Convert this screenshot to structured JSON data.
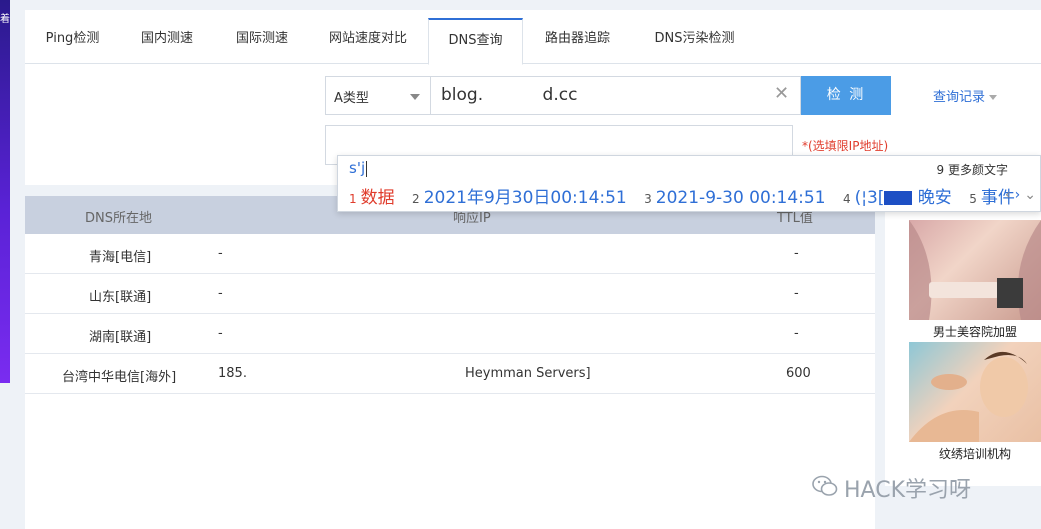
{
  "left_strip": {
    "glyph": "着"
  },
  "tabs": [
    {
      "label": "Ping检测"
    },
    {
      "label": "国内测速"
    },
    {
      "label": "国际测速"
    },
    {
      "label": "网站速度对比"
    },
    {
      "label": "DNS查询"
    },
    {
      "label": "路由器追踪"
    },
    {
      "label": "DNS污染检测"
    }
  ],
  "active_tab": "DNS查询",
  "query": {
    "type_value": "A类型",
    "domain_value": "blog.           d.cc",
    "check_button": "检  测",
    "history_link": "查询记录",
    "ip_placeholder": "",
    "ip_hint": "*(选填限IP地址)"
  },
  "ime": {
    "composition": "s'j",
    "more_label": "9 更多颜文字",
    "candidates": [
      {
        "num": "1",
        "text": "数据"
      },
      {
        "num": "2",
        "text": "2021年9月30日00:14:51"
      },
      {
        "num": "3",
        "text": "2021-9-30 00:14:51"
      },
      {
        "num": "4",
        "text": "(¦3[",
        "suffix": " 晚安"
      },
      {
        "num": "5",
        "text": "事件"
      }
    ],
    "nav_prev": "‹",
    "nav_next": "›",
    "nav_expand": "⌄"
  },
  "table": {
    "headers": {
      "location": "DNS所在地",
      "ip": "响应IP",
      "ttl": "TTL值"
    },
    "rows": [
      {
        "location": "青海[电信]",
        "ip": "-",
        "ip_extra": "",
        "ttl": "-"
      },
      {
        "location": "山东[联通]",
        "ip": "-",
        "ip_extra": "",
        "ttl": "-"
      },
      {
        "location": "湖南[联通]",
        "ip": "-",
        "ip_extra": "",
        "ttl": "-"
      },
      {
        "location": "台湾中华电信[海外]",
        "ip": "185.",
        "ip_extra": "Heymman Servers]",
        "ttl": "600"
      }
    ]
  },
  "ads": [
    {
      "label": "男士美容院加盟"
    },
    {
      "label": "纹绣培训机构"
    }
  ],
  "watermark": {
    "icon": "wechat-icon",
    "text": "HACK学习呀"
  }
}
